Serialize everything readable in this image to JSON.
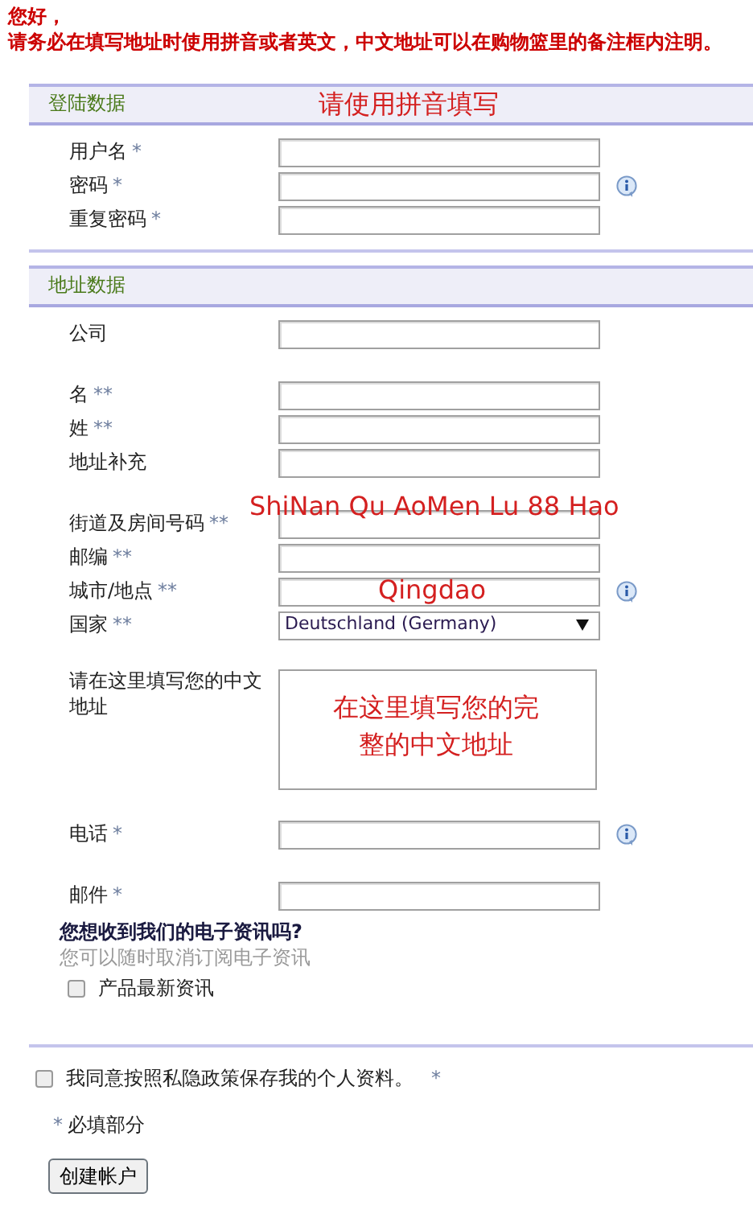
{
  "greeting": [
    "您好，",
    "请务必在填写地址时使用拼音或者英文，中文地址可以在购物篮里的备注框内注明。"
  ],
  "sections": [
    {
      "title": "登陆数据",
      "annotation": "请使用拼音填写",
      "groups": [
        [
          {
            "kind": "text",
            "label": "用户名",
            "required": "*",
            "info": false
          },
          {
            "kind": "text",
            "label": "密码",
            "required": "*",
            "info": true
          },
          {
            "kind": "text",
            "label": "重复密码",
            "required": "*",
            "info": false
          }
        ]
      ]
    },
    {
      "title": "地址数据",
      "groups": [
        [
          {
            "kind": "text",
            "label": "公司",
            "info": false
          }
        ],
        [
          {
            "kind": "text",
            "label": "名",
            "required": "**",
            "info": false
          },
          {
            "kind": "text",
            "label": "姓",
            "required": "**",
            "info": false
          },
          {
            "kind": "text",
            "label": "地址补充",
            "info": false
          }
        ],
        [
          {
            "kind": "text",
            "label": "街道及房间号码",
            "required": "**",
            "info": false,
            "annotation": "ShiNan Qu AoMen Lu 88 Hao"
          },
          {
            "kind": "text",
            "label": "邮编",
            "required": "**",
            "info": false
          },
          {
            "kind": "text",
            "label": "城市/地点",
            "required": "**",
            "info": true,
            "annotation": "Qingdao"
          },
          {
            "kind": "select",
            "label": "国家",
            "required": "**",
            "info": false,
            "value": "Deutschland (Germany)"
          }
        ],
        [
          {
            "kind": "textarea",
            "label": "请在这里填写您的中文地址",
            "info": false,
            "annotation": "在这里填写您的完整的中文地址"
          }
        ],
        [
          {
            "kind": "text",
            "label": "电话",
            "required": "*",
            "info": true
          }
        ],
        [
          {
            "kind": "text",
            "label": "邮件",
            "required": "*",
            "info": false
          }
        ]
      ]
    }
  ],
  "newsletter": {
    "title": "您想收到我们的电子资讯吗?",
    "subtitle": "您可以随时取消订阅电子资讯",
    "options": [
      {
        "label": "产品最新资讯",
        "checked": false
      }
    ]
  },
  "privacy": {
    "label": "我同意按照私隐政策保存我的个人资料。",
    "required": "*",
    "checked": false
  },
  "required_note": {
    "mark": "*",
    "text": "必填部分"
  },
  "submit": "创建帐户"
}
